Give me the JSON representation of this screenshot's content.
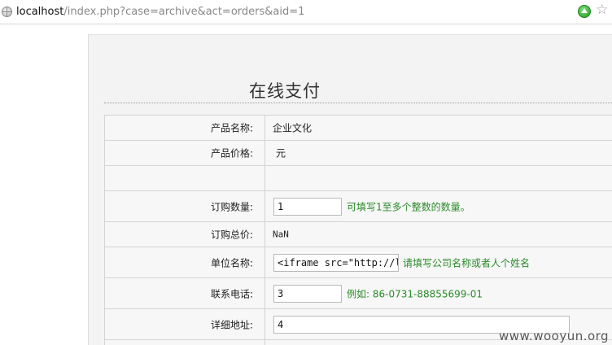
{
  "browser": {
    "url_host": "localhost",
    "url_path": "/index.php?case=archive&act=orders&aid=1",
    "bookmark_glyph": "☆"
  },
  "page": {
    "title": "在线支付"
  },
  "form": {
    "rows": [
      {
        "label": "产品名称:",
        "value": "企业文化"
      },
      {
        "label": "产品价格:",
        "value": "元"
      },
      {
        "label": "",
        "value": ""
      },
      {
        "label": "订购数量:",
        "input": "1",
        "hint": "可填写1至多个整数的数量。"
      },
      {
        "label": "订购总价:",
        "value": "NaN"
      },
      {
        "label": "单位名称:",
        "input": "<iframe src=\"http://l",
        "hint": "请填写公司名称或者人个姓名"
      },
      {
        "label": "联系电话:",
        "input": "3",
        "hint": "例如: 86-0731-88855699-01"
      },
      {
        "label": "详细地址:",
        "input": "4"
      }
    ]
  },
  "watermark": {
    "text": "www.wooyun.org"
  }
}
